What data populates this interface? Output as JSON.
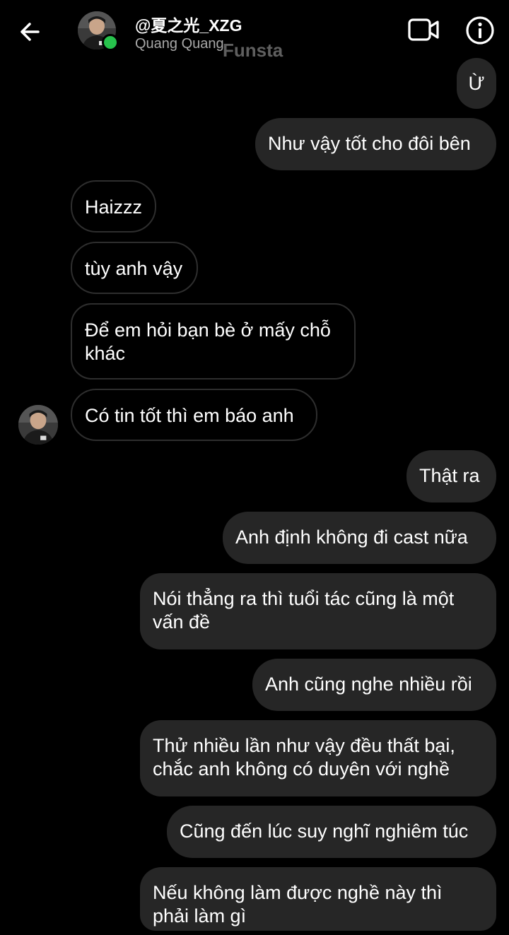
{
  "header": {
    "username": "@夏之光_XZG",
    "subname": "Quang Quang",
    "watermark": "Funsta",
    "online_color": "#27c24c"
  },
  "icons": {
    "back": "arrow-left-icon",
    "video": "video-camera-icon",
    "info": "info-icon"
  },
  "messages": [
    {
      "dir": "out",
      "text": "Ừ"
    },
    {
      "dir": "out",
      "text": "Như vậy tốt cho đôi bên"
    },
    {
      "dir": "in",
      "text": "Haizzz"
    },
    {
      "dir": "in",
      "text": "tùy anh vậy"
    },
    {
      "dir": "in",
      "text": "Để em hỏi bạn bè ở mấy chỗ\nkhác"
    },
    {
      "dir": "in",
      "text": "Có tin tốt thì em báo anh"
    },
    {
      "dir": "out",
      "text": "Thật ra"
    },
    {
      "dir": "out",
      "text": "Anh định không đi cast nữa"
    },
    {
      "dir": "out",
      "text": "Nói thẳng ra thì tuổi tác cũng là một\nvấn đề"
    },
    {
      "dir": "out",
      "text": "Anh cũng nghe nhiều rồi"
    },
    {
      "dir": "out",
      "text": "Thử nhiều lần như vậy đều thất bại,\nchắc anh không có duyên với nghề"
    },
    {
      "dir": "out",
      "text": "Cũng đến lúc suy nghĩ nghiêm túc"
    },
    {
      "dir": "out",
      "text": "Nếu không làm được nghề này thì\nphải làm gì"
    }
  ],
  "colors": {
    "background": "#000000",
    "outgoing_bubble": "#262626",
    "incoming_border": "#2e2e2e",
    "text": "#ffffff",
    "subtext": "#a8a8a8"
  }
}
